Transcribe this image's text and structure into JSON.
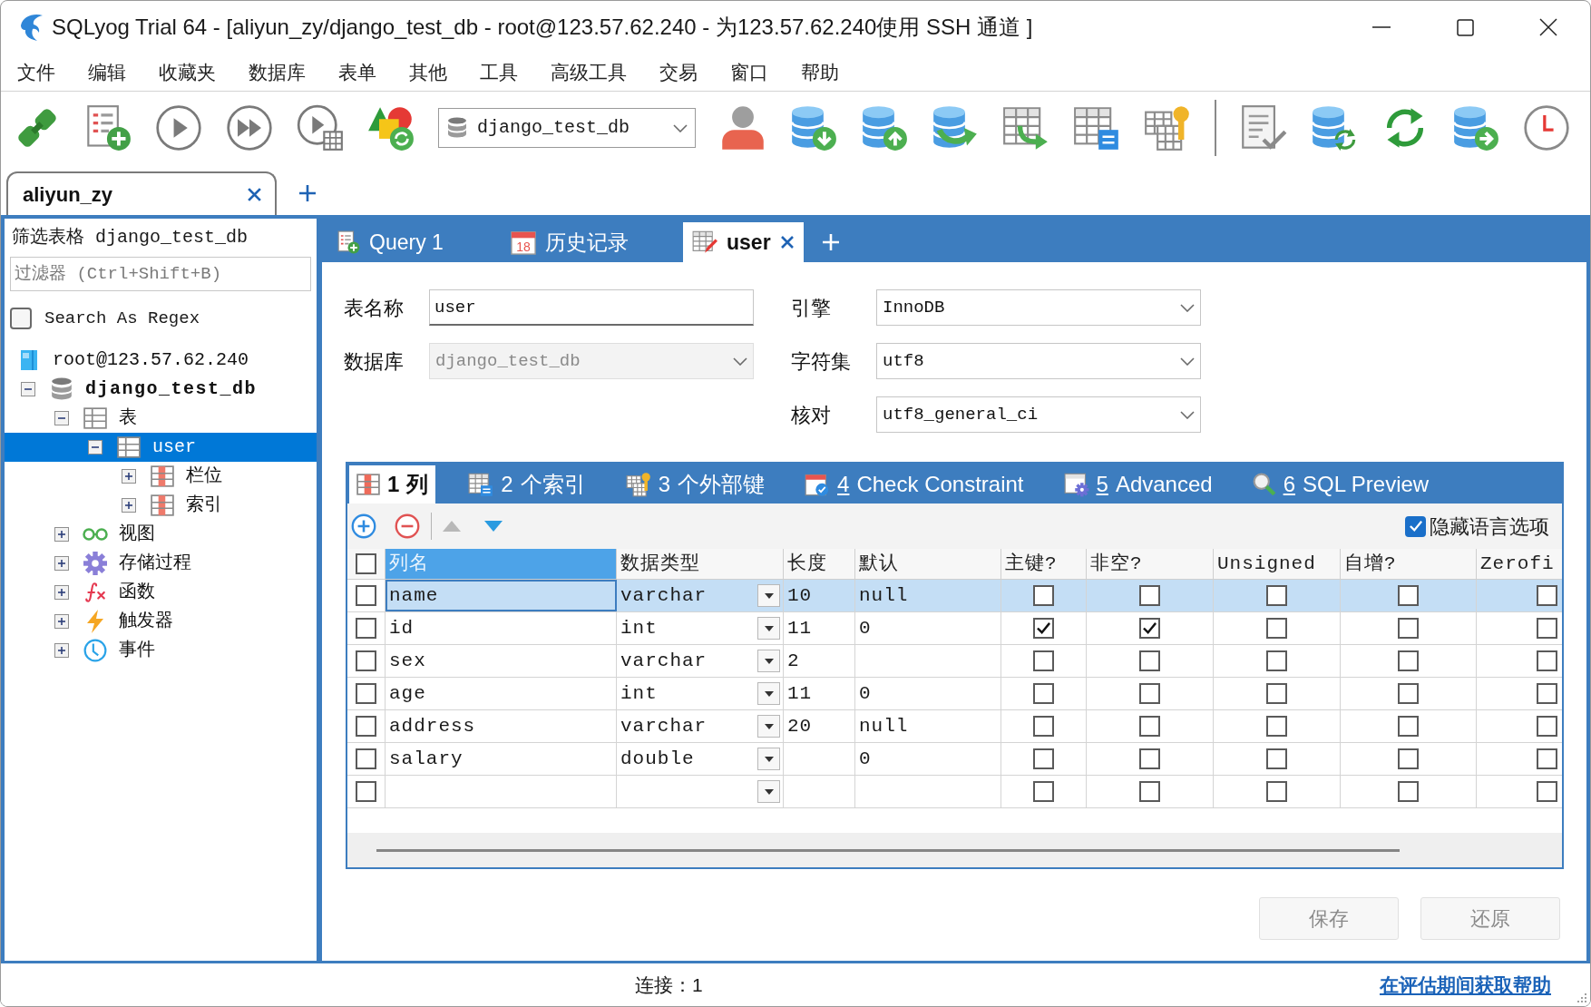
{
  "window": {
    "title": "SQLyog Trial 64 - [aliyun_zy/django_test_db - root@123.57.62.240 - 为123.57.62.240使用 SSH 通道 ]"
  },
  "menu": [
    "文件",
    "编辑",
    "收藏夹",
    "数据库",
    "表单",
    "其他",
    "工具",
    "高级工具",
    "交易",
    "窗口",
    "帮助"
  ],
  "toolbar": {
    "database": "django_test_db"
  },
  "connection_tabs": [
    {
      "label": "aliyun_zy",
      "selected": true
    }
  ],
  "object_browser": {
    "title": "筛选表格 django_test_db",
    "filter": {
      "placeholder": "过滤器 (Ctrl+Shift+B)"
    },
    "regex": {
      "label": "Search As Regex",
      "checked": false
    },
    "tree": [
      {
        "label": "root@123.57.62.240",
        "kind": "server",
        "selected": false,
        "children": [
          {
            "label": "django_test_db",
            "kind": "database",
            "expanded": true,
            "selected": false,
            "children": [
              {
                "label": "表",
                "kind": "table",
                "expanded": true,
                "selected": false,
                "children": [
                  {
                    "label": "user",
                    "kind": "table",
                    "expanded": true,
                    "selected": true,
                    "children": [
                      {
                        "label": "栏位",
                        "kind": "group",
                        "expanded": false,
                        "selected": false
                      },
                      {
                        "label": "索引",
                        "kind": "group",
                        "expanded": false,
                        "selected": false
                      }
                    ]
                  }
                ]
              },
              {
                "label": "视图",
                "kind": "views",
                "expanded": false,
                "selected": false
              },
              {
                "label": "存储过程",
                "kind": "procedures",
                "expanded": false,
                "selected": false
              },
              {
                "label": "函数",
                "kind": "functions",
                "expanded": false,
                "selected": false
              },
              {
                "label": "触发器",
                "kind": "triggers",
                "expanded": false,
                "selected": false
              },
              {
                "label": "事件",
                "kind": "events",
                "expanded": false,
                "selected": false
              }
            ]
          }
        ]
      }
    ]
  },
  "query_tabs": [
    {
      "label": "Query 1",
      "kind": "query",
      "selected": false,
      "closable": false
    },
    {
      "label": "历史记录",
      "kind": "history",
      "icon_label": "18",
      "selected": false,
      "closable": false
    },
    {
      "label": "user",
      "kind": "table",
      "selected": true,
      "closable": true
    }
  ],
  "table_form": {
    "left": [
      {
        "label": "表名称",
        "value": "user",
        "kind": "text",
        "disabled": false
      },
      {
        "label": "数据库",
        "value": "django_test_db",
        "kind": "select",
        "disabled": true
      }
    ],
    "right": [
      {
        "label": "引擎",
        "value": "InnoDB",
        "kind": "select",
        "disabled": false
      },
      {
        "label": "字符集",
        "value": "utf8",
        "kind": "select",
        "disabled": false
      },
      {
        "label": "核对",
        "value": "utf8_general_ci",
        "kind": "select",
        "disabled": false
      }
    ]
  },
  "editor_tabs": [
    {
      "number": "1",
      "label": "列",
      "kind": "columns",
      "selected": true,
      "accelerator": false
    },
    {
      "number": "2",
      "label": "个索引",
      "kind": "indexes",
      "selected": false,
      "accelerator": false
    },
    {
      "number": "3",
      "label": "个外部键",
      "kind": "foreign-keys",
      "selected": false,
      "accelerator": false
    },
    {
      "number": "4",
      "label": "Check Constraint",
      "kind": "checks",
      "selected": false,
      "accelerator": true
    },
    {
      "number": "5",
      "label": "Advanced",
      "kind": "advanced",
      "selected": false,
      "accelerator": true
    },
    {
      "number": "6",
      "label": "SQL Preview",
      "kind": "preview",
      "selected": false,
      "accelerator": true
    }
  ],
  "grid_toolbar": [
    {
      "kind": "add",
      "disabled": false
    },
    {
      "kind": "remove",
      "disabled": false
    },
    {
      "kind": "move-up",
      "disabled": true
    },
    {
      "kind": "move-down",
      "disabled": false
    }
  ],
  "hide_language_options": {
    "label": "隐藏语言选项",
    "checked": true
  },
  "grid": {
    "header_checked": false,
    "columns": [
      {
        "label": "列名",
        "selected": true
      },
      {
        "label": "数据类型",
        "selected": false
      },
      {
        "label": "长度",
        "selected": false
      },
      {
        "label": "默认",
        "selected": false
      },
      {
        "label": "主键?",
        "selected": false
      },
      {
        "label": "非空?",
        "selected": false
      },
      {
        "label": "Unsigned",
        "selected": false
      },
      {
        "label": "自增?",
        "selected": false
      },
      {
        "label": "Zerofi",
        "selected": false
      }
    ],
    "rows": [
      {
        "selected": true,
        "checked": false,
        "name": "name",
        "data_type": "varchar",
        "length": "10",
        "default": "null",
        "primary_key": false,
        "not_null": false,
        "unsigned": false,
        "auto_increment": false,
        "zerofill": false
      },
      {
        "selected": false,
        "checked": false,
        "name": "id",
        "data_type": "int",
        "length": "11",
        "default": "0",
        "primary_key": true,
        "not_null": true,
        "unsigned": false,
        "auto_increment": false,
        "zerofill": false
      },
      {
        "selected": false,
        "checked": false,
        "name": "sex",
        "data_type": "varchar",
        "length": "2",
        "primary_key": false,
        "not_null": false,
        "unsigned": false,
        "auto_increment": false,
        "zerofill": false
      },
      {
        "selected": false,
        "checked": false,
        "name": "age",
        "data_type": "int",
        "length": "11",
        "default": "0",
        "primary_key": false,
        "not_null": false,
        "unsigned": false,
        "auto_increment": false,
        "zerofill": false
      },
      {
        "selected": false,
        "checked": false,
        "name": "address",
        "data_type": "varchar",
        "length": "20",
        "default": "null",
        "primary_key": false,
        "not_null": false,
        "unsigned": false,
        "auto_increment": false,
        "zerofill": false
      },
      {
        "selected": false,
        "checked": false,
        "name": "salary",
        "data_type": "double",
        "default": "0",
        "primary_key": false,
        "not_null": false,
        "unsigned": false,
        "auto_increment": false,
        "zerofill": false
      },
      {
        "selected": false,
        "checked": false,
        "primary_key": false,
        "not_null": false,
        "unsigned": false,
        "auto_increment": false,
        "zerofill": false
      }
    ]
  },
  "actions": [
    {
      "label": "保存",
      "disabled": true
    },
    {
      "label": "还原",
      "disabled": true
    }
  ],
  "status_bar": {
    "connections": "连接：1",
    "help_link": "在评估期间获取帮助"
  }
}
